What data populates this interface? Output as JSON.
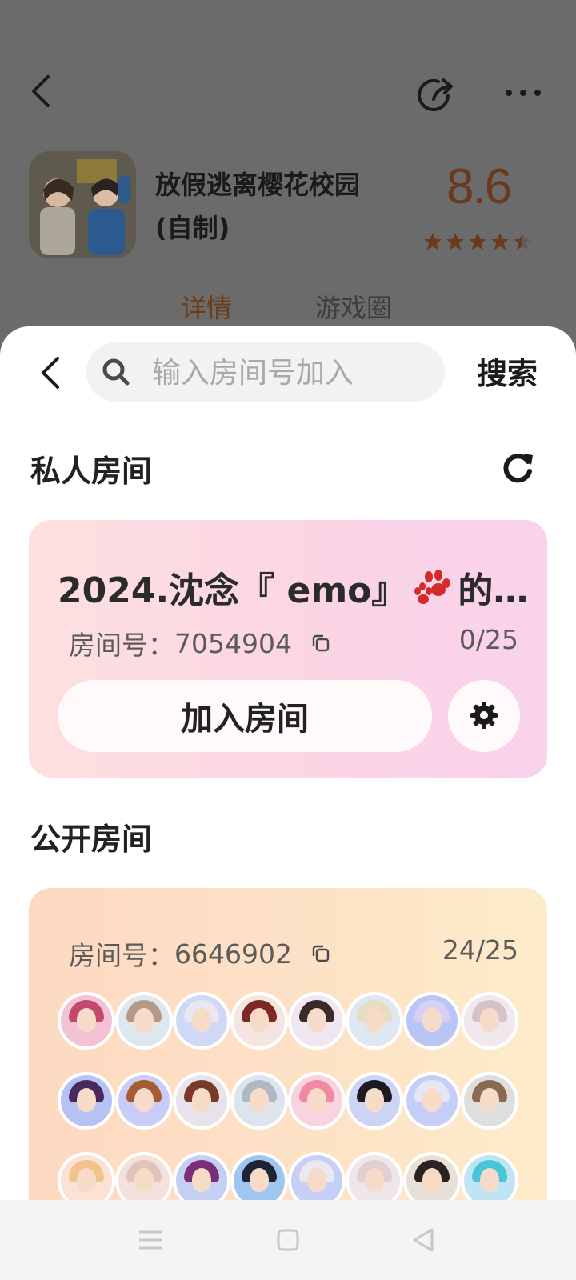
{
  "background_page": {
    "game_title": "放假逃离樱花校园(自制)",
    "rating": "8.6",
    "tabs": [
      "详情",
      "游戏圈"
    ],
    "icons": [
      "back-icon",
      "share-icon",
      "more-icon"
    ],
    "rating_stars": 4.5
  },
  "search": {
    "placeholder": "输入房间号加入",
    "value": "",
    "button_label": "搜索"
  },
  "private_section": {
    "title": "私人房间",
    "room": {
      "name_prefix": "2024.沈念『 emo』",
      "name_suffix": "的…",
      "room_id_label": "房间号：",
      "room_id": "7054904",
      "count": "0/25",
      "join_label": "加入房间"
    }
  },
  "public_section": {
    "title": "公开房间",
    "room": {
      "room_id_label": "房间号：",
      "room_id": "6646902",
      "count": "24/25",
      "avatars": [
        {
          "bg": "#f3c2d6",
          "hair": "#c2486e"
        },
        {
          "bg": "#dfe7ee",
          "hair": "#b49a86"
        },
        {
          "bg": "#cfd9f6",
          "hair": "#e9e7f4"
        },
        {
          "bg": "#f4e5e0",
          "hair": "#7a2a22"
        },
        {
          "bg": "#efe6f2",
          "hair": "#3a2a2a"
        },
        {
          "bg": "#dfe7f0",
          "hair": "#e8dcc2"
        },
        {
          "bg": "#b9c6f5",
          "hair": "#d8d0f4"
        },
        {
          "bg": "#f0e8ee",
          "hair": "#d4c2c8"
        },
        {
          "bg": "#b6c2f4",
          "hair": "#4a2a5e"
        },
        {
          "bg": "#c8ccf6",
          "hair": "#a85a30"
        },
        {
          "bg": "#e8e2ea",
          "hair": "#7a3a2a"
        },
        {
          "bg": "#dde4ee",
          "hair": "#b0b8c4"
        },
        {
          "bg": "#f8d4de",
          "hair": "#f08aa4"
        },
        {
          "bg": "#ccd4f4",
          "hair": "#1e1a22"
        },
        {
          "bg": "#c4cef8",
          "hair": "#e8e6f2"
        },
        {
          "bg": "#dedede",
          "hair": "#8a6a52"
        },
        {
          "bg": "#fbe2d4",
          "hair": "#f2c48a"
        },
        {
          "bg": "#f4e0dc",
          "hair": "#e0c4bc"
        },
        {
          "bg": "#c4cff2",
          "hair": "#7a2e78"
        },
        {
          "bg": "#9ec6ee",
          "hair": "#1e2436"
        },
        {
          "bg": "#c8cff6",
          "hair": "#ece8f0"
        },
        {
          "bg": "#efe6ea",
          "hair": "#e2cfd2"
        },
        {
          "bg": "#e8dfd6",
          "hair": "#2a2420"
        },
        {
          "bg": "#bfe4f4",
          "hair": "#48c6d8"
        }
      ]
    }
  },
  "navbar": {
    "icons": [
      "menu-icon",
      "home-square-icon",
      "back-triangle-icon"
    ]
  },
  "colors": {
    "dim_background": "#6b6b6b",
    "rating_color": "#6a3a1c",
    "active_tab": "#6d3c18",
    "private_card_gradient": [
      "#fde0e0",
      "#f9d2ec"
    ],
    "public_card_gradient": [
      "#fdd9c2",
      "#fdeccb"
    ]
  }
}
